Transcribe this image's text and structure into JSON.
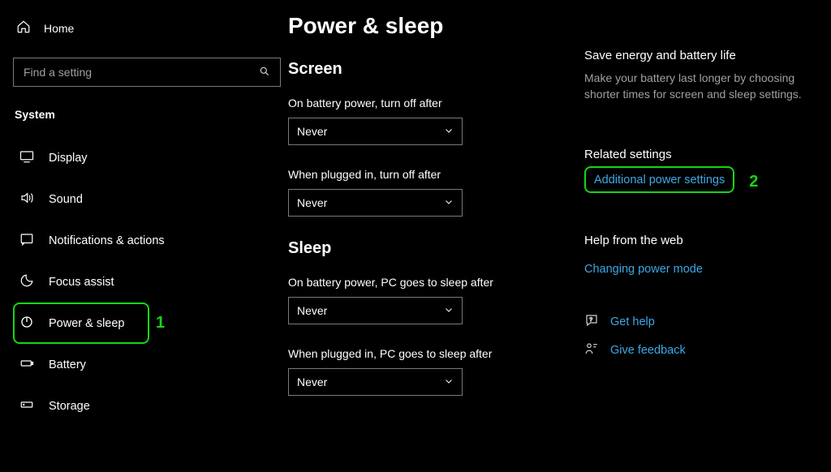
{
  "sidebar": {
    "home_label": "Home",
    "search_placeholder": "Find a setting",
    "section_label": "System",
    "items": [
      {
        "label": "Display"
      },
      {
        "label": "Sound"
      },
      {
        "label": "Notifications & actions"
      },
      {
        "label": "Focus assist"
      },
      {
        "label": "Power & sleep"
      },
      {
        "label": "Battery"
      },
      {
        "label": "Storage"
      }
    ]
  },
  "page": {
    "title": "Power & sleep",
    "screen_heading": "Screen",
    "sleep_heading": "Sleep",
    "screen_battery_label": "On battery power, turn off after",
    "screen_plugged_label": "When plugged in, turn off after",
    "sleep_battery_label": "On battery power, PC goes to sleep after",
    "sleep_plugged_label": "When plugged in, PC goes to sleep after",
    "screen_battery_value": "Never",
    "screen_plugged_value": "Never",
    "sleep_battery_value": "Never",
    "sleep_plugged_value": "Never"
  },
  "right": {
    "save_heading": "Save energy and battery life",
    "save_body": "Make your battery last longer by choosing shorter times for screen and sleep settings.",
    "related_heading": "Related settings",
    "additional_power": "Additional power settings",
    "help_web_heading": "Help from the web",
    "changing_power_mode": "Changing power mode",
    "get_help": "Get help",
    "give_feedback": "Give feedback"
  },
  "annotations": {
    "one": "1",
    "two": "2"
  }
}
